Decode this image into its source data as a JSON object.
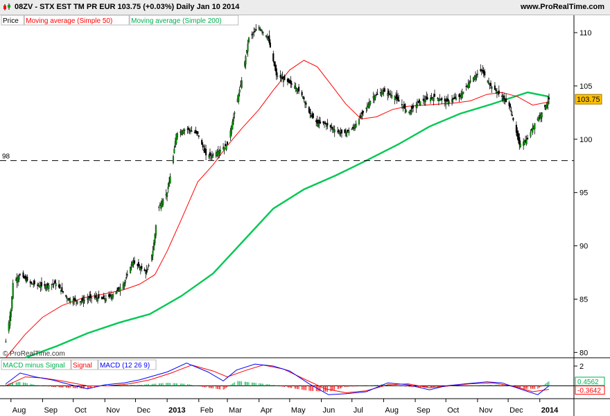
{
  "header": {
    "title": "08ZV - STX EST TM PR EUR    103.75 (+0.03%)    Daily  Jan 10 2014",
    "site": "www.ProRealTime.com"
  },
  "price_panel": {
    "legend": [
      {
        "label": "Price",
        "color": "#000000"
      },
      {
        "label": "Moving average (Simple 50)",
        "color": "#ff0000"
      },
      {
        "label": "Moving average (Simple 200)",
        "color": "#00b050"
      }
    ],
    "watermark": "© ProRealTime.com",
    "level_label": "98",
    "last_label": "103.75"
  },
  "macd_panel": {
    "legend": [
      {
        "label": "MACD minus Signal",
        "color": "#00b050"
      },
      {
        "label": "Signal",
        "color": "#ff0000"
      },
      {
        "label": "MACD (12 26 9)",
        "color": "#0000ff"
      }
    ],
    "labels": {
      "pos": "0.4562",
      "neg": "-0.3642"
    }
  },
  "colors": {
    "up": "#00a000",
    "down": "#000000",
    "ma50": "#ff0000",
    "ma200": "#00c853",
    "macd": "#0000ff",
    "signal": "#ff0000",
    "hist_pos": "#00b050",
    "hist_neg": "#ff0000",
    "last": "#ffc000"
  },
  "chart_data": [
    {
      "type": "candlestick",
      "title": "08ZV - STX EST TM PR EUR",
      "ylim": [
        79.5,
        111.5
      ],
      "yticks": [
        80,
        85,
        90,
        95,
        100,
        105,
        110
      ],
      "xticks": [
        "Aug",
        "Sep",
        "Oct",
        "Nov",
        "Dec",
        "2013",
        "Feb",
        "Mar",
        "Apr",
        "May",
        "Jun",
        "Jul",
        "Aug",
        "Sep",
        "Oct",
        "Nov",
        "Dec",
        "2014"
      ],
      "horizontal_line": 98,
      "last_value": 103.75,
      "series": [
        {
          "name": "Price",
          "points": [
            [
              "2012-07-27",
              81.0
            ],
            [
              "2012-08-01",
              84.0
            ],
            [
              "2012-08-03",
              86.5
            ],
            [
              "2012-08-10",
              87.3
            ],
            [
              "2012-08-20",
              86.5
            ],
            [
              "2012-09-01",
              86.2
            ],
            [
              "2012-09-14",
              86.5
            ],
            [
              "2012-09-26",
              85.0
            ],
            [
              "2012-10-08",
              84.8
            ],
            [
              "2012-10-20",
              85.2
            ],
            [
              "2012-11-01",
              85.0
            ],
            [
              "2012-11-10",
              85.5
            ],
            [
              "2012-11-20",
              86.5
            ],
            [
              "2012-11-28",
              88.5
            ],
            [
              "2012-12-05",
              88.0
            ],
            [
              "2012-12-12",
              87.5
            ],
            [
              "2012-12-18",
              89.5
            ],
            [
              "2012-12-23",
              93.5
            ],
            [
              "2013-01-01",
              95.0
            ],
            [
              "2013-01-05",
              97.0
            ],
            [
              "2013-01-10",
              100.5
            ],
            [
              "2013-01-20",
              101.0
            ],
            [
              "2013-01-31",
              100.5
            ],
            [
              "2013-02-08",
              98.5
            ],
            [
              "2013-02-14",
              98.5
            ],
            [
              "2013-02-22",
              99.0
            ],
            [
              "2013-03-01",
              99.5
            ],
            [
              "2013-03-08",
              102.5
            ],
            [
              "2013-03-15",
              105.5
            ],
            [
              "2013-03-22",
              109.5
            ],
            [
              "2013-04-01",
              110.5
            ],
            [
              "2013-04-10",
              109.5
            ],
            [
              "2013-04-18",
              106.0
            ],
            [
              "2013-04-27",
              105.5
            ],
            [
              "2013-05-06",
              105.0
            ],
            [
              "2013-05-14",
              104.0
            ],
            [
              "2013-05-20",
              102.5
            ],
            [
              "2013-05-28",
              101.5
            ],
            [
              "2013-06-04",
              101.5
            ],
            [
              "2013-06-12",
              101.0
            ],
            [
              "2013-06-22",
              100.5
            ],
            [
              "2013-07-02",
              101.0
            ],
            [
              "2013-07-12",
              102.5
            ],
            [
              "2013-07-22",
              104.0
            ],
            [
              "2013-08-01",
              104.5
            ],
            [
              "2013-08-12",
              104.0
            ],
            [
              "2013-08-25",
              102.5
            ],
            [
              "2013-09-05",
              103.5
            ],
            [
              "2013-09-20",
              104.0
            ],
            [
              "2013-10-01",
              103.5
            ],
            [
              "2013-10-15",
              104.0
            ],
            [
              "2013-10-25",
              105.5
            ],
            [
              "2013-11-05",
              106.5
            ],
            [
              "2013-11-14",
              105.0
            ],
            [
              "2013-11-25",
              104.0
            ],
            [
              "2013-12-03",
              103.0
            ],
            [
              "2013-12-08",
              101.0
            ],
            [
              "2013-12-12",
              99.5
            ],
            [
              "2013-12-20",
              100.0
            ],
            [
              "2013-12-27",
              101.5
            ],
            [
              "2014-01-03",
              102.5
            ],
            [
              "2014-01-10",
              103.75
            ]
          ]
        },
        {
          "name": "Moving average (Simple 50)",
          "points": [
            [
              "2012-07-27",
              79.5
            ],
            [
              "2012-08-15",
              81.7
            ],
            [
              "2012-09-01",
              83.3
            ],
            [
              "2012-09-20",
              84.4
            ],
            [
              "2012-10-10",
              85.1
            ],
            [
              "2012-11-01",
              85.5
            ],
            [
              "2012-11-20",
              85.9
            ],
            [
              "2012-12-05",
              86.4
            ],
            [
              "2012-12-20",
              87.3
            ],
            [
              "2013-01-01",
              89.5
            ],
            [
              "2013-01-15",
              92.5
            ],
            [
              "2013-01-31",
              96.0
            ],
            [
              "2013-02-15",
              97.6
            ],
            [
              "2013-03-01",
              99.4
            ],
            [
              "2013-03-15",
              101.0
            ],
            [
              "2013-04-01",
              102.8
            ],
            [
              "2013-04-15",
              104.6
            ],
            [
              "2013-05-01",
              106.5
            ],
            [
              "2013-05-15",
              107.4
            ],
            [
              "2013-05-28",
              106.8
            ],
            [
              "2013-06-10",
              105.2
            ],
            [
              "2013-06-25",
              103.3
            ],
            [
              "2013-07-10",
              101.9
            ],
            [
              "2013-07-25",
              102.1
            ],
            [
              "2013-08-10",
              102.8
            ],
            [
              "2013-08-25",
              103.1
            ],
            [
              "2013-09-10",
              103.2
            ],
            [
              "2013-09-25",
              103.3
            ],
            [
              "2013-10-10",
              103.4
            ],
            [
              "2013-10-25",
              103.6
            ],
            [
              "2013-11-10",
              104.2
            ],
            [
              "2013-11-25",
              104.4
            ],
            [
              "2013-12-10",
              104.0
            ],
            [
              "2013-12-25",
              103.2
            ],
            [
              "2014-01-10",
              103.5
            ]
          ]
        },
        {
          "name": "Moving average (Simple 200)",
          "points": [
            [
              "2012-08-15",
              79.5
            ],
            [
              "2012-09-15",
              80.6
            ],
            [
              "2012-10-15",
              81.8
            ],
            [
              "2012-11-15",
              82.8
            ],
            [
              "2012-12-15",
              83.6
            ],
            [
              "2013-01-15",
              85.3
            ],
            [
              "2013-02-15",
              87.4
            ],
            [
              "2013-03-15",
              90.3
            ],
            [
              "2013-04-15",
              93.5
            ],
            [
              "2013-05-15",
              95.3
            ],
            [
              "2013-06-15",
              96.6
            ],
            [
              "2013-07-15",
              98.0
            ],
            [
              "2013-08-15",
              99.5
            ],
            [
              "2013-09-15",
              101.2
            ],
            [
              "2013-10-15",
              102.4
            ],
            [
              "2013-11-15",
              103.3
            ],
            [
              "2013-12-01",
              103.8
            ],
            [
              "2013-12-20",
              104.4
            ],
            [
              "2014-01-10",
              104.0
            ]
          ]
        }
      ]
    },
    {
      "type": "line",
      "title": "MACD (12 26 9)",
      "ylim": [
        -1.3,
        2.7
      ],
      "yticks": [
        0,
        2
      ],
      "series": [
        {
          "name": "MACD (12 26 9)",
          "points": [
            [
              "2012-07-27",
              0.2
            ],
            [
              "2012-08-10",
              1.3
            ],
            [
              "2012-08-25",
              0.9
            ],
            [
              "2012-09-10",
              0.6
            ],
            [
              "2012-09-25",
              0.2
            ],
            [
              "2012-10-15",
              -0.3
            ],
            [
              "2012-11-01",
              0.1
            ],
            [
              "2012-11-20",
              0.3
            ],
            [
              "2012-12-05",
              0.6
            ],
            [
              "2013-01-01",
              1.4
            ],
            [
              "2013-01-20",
              2.3
            ],
            [
              "2013-02-10",
              1.4
            ],
            [
              "2013-02-25",
              0.5
            ],
            [
              "2013-03-10",
              1.6
            ],
            [
              "2013-03-28",
              2.2
            ],
            [
              "2013-04-15",
              2.0
            ],
            [
              "2013-05-01",
              1.5
            ],
            [
              "2013-05-20",
              0.2
            ],
            [
              "2013-06-08",
              -0.9
            ],
            [
              "2013-06-25",
              -0.8
            ],
            [
              "2013-07-15",
              -0.6
            ],
            [
              "2013-08-05",
              0.3
            ],
            [
              "2013-08-25",
              0.1
            ],
            [
              "2013-09-15",
              -0.4
            ],
            [
              "2013-10-01",
              0.0
            ],
            [
              "2013-10-20",
              0.2
            ],
            [
              "2013-11-10",
              0.4
            ],
            [
              "2013-11-25",
              0.3
            ],
            [
              "2013-12-15",
              -0.4
            ],
            [
              "2013-12-30",
              -0.9
            ],
            [
              "2014-01-10",
              0.0
            ]
          ]
        },
        {
          "name": "Signal",
          "points": [
            [
              "2012-07-27",
              0.0
            ],
            [
              "2012-08-15",
              0.9
            ],
            [
              "2012-09-01",
              0.8
            ],
            [
              "2012-09-20",
              0.5
            ],
            [
              "2012-10-15",
              0.0
            ],
            [
              "2012-11-05",
              0.0
            ],
            [
              "2012-11-25",
              0.2
            ],
            [
              "2012-12-15",
              0.6
            ],
            [
              "2013-01-05",
              1.3
            ],
            [
              "2013-01-25",
              2.1
            ],
            [
              "2013-02-15",
              1.5
            ],
            [
              "2013-03-01",
              0.9
            ],
            [
              "2013-03-20",
              1.6
            ],
            [
              "2013-04-05",
              2.1
            ],
            [
              "2013-04-25",
              1.7
            ],
            [
              "2013-05-15",
              0.7
            ],
            [
              "2013-06-05",
              -0.3
            ],
            [
              "2013-06-25",
              -0.7
            ],
            [
              "2013-07-15",
              -0.5
            ],
            [
              "2013-08-05",
              0.1
            ],
            [
              "2013-08-25",
              0.2
            ],
            [
              "2013-09-15",
              -0.2
            ],
            [
              "2013-10-05",
              0.0
            ],
            [
              "2013-10-25",
              0.2
            ],
            [
              "2013-11-15",
              0.3
            ],
            [
              "2013-12-05",
              0.0
            ],
            [
              "2013-12-25",
              -0.6
            ],
            [
              "2014-01-10",
              -0.36
            ]
          ]
        },
        {
          "name": "MACD minus Signal",
          "points": [
            [
              "2012-07-27",
              0.2
            ],
            [
              "2012-08-10",
              0.4
            ],
            [
              "2012-08-25",
              0.1
            ],
            [
              "2012-09-10",
              -0.1
            ],
            [
              "2012-09-25",
              -0.2
            ],
            [
              "2012-10-15",
              -0.3
            ],
            [
              "2012-11-01",
              0.1
            ],
            [
              "2012-11-20",
              0.1
            ],
            [
              "2012-12-05",
              0.1
            ],
            [
              "2013-01-01",
              0.3
            ],
            [
              "2013-01-20",
              0.2
            ],
            [
              "2013-02-10",
              -0.2
            ],
            [
              "2013-02-25",
              -0.4
            ],
            [
              "2013-03-10",
              0.5
            ],
            [
              "2013-03-28",
              0.3
            ],
            [
              "2013-04-15",
              0.1
            ],
            [
              "2013-05-01",
              -0.2
            ],
            [
              "2013-05-20",
              -0.5
            ],
            [
              "2013-06-08",
              -0.6
            ],
            [
              "2013-06-25",
              -0.1
            ],
            [
              "2013-07-15",
              0.0
            ],
            [
              "2013-08-05",
              0.2
            ],
            [
              "2013-08-25",
              -0.1
            ],
            [
              "2013-09-15",
              -0.2
            ],
            [
              "2013-10-01",
              0.0
            ],
            [
              "2013-10-20",
              0.0
            ],
            [
              "2013-11-10",
              0.1
            ],
            [
              "2013-11-25",
              0.1
            ],
            [
              "2013-12-15",
              -0.3
            ],
            [
              "2013-12-30",
              -0.3
            ],
            [
              "2014-01-10",
              0.46
            ]
          ]
        }
      ]
    }
  ]
}
